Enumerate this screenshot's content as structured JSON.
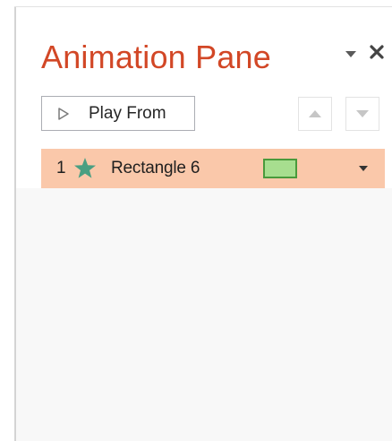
{
  "pane": {
    "title": "Animation Pane",
    "menu_icon": "chevron-down-icon",
    "close_icon": "close-icon"
  },
  "toolbar": {
    "play_label": "Play From",
    "play_icon": "play-icon",
    "move_up_icon": "triangle-up-icon",
    "move_down_icon": "triangle-down-icon"
  },
  "animations": [
    {
      "number": "1",
      "effect_icon": "star-icon",
      "name": "Rectangle 6",
      "timing_color": "#a7de8f",
      "dropdown_icon": "chevron-down-icon"
    }
  ],
  "colors": {
    "title": "#d24726",
    "selected_row": "#fac8aa",
    "star": "#4a9f82",
    "timing_fill": "#a7de8f",
    "timing_border": "#4a9a3c"
  }
}
